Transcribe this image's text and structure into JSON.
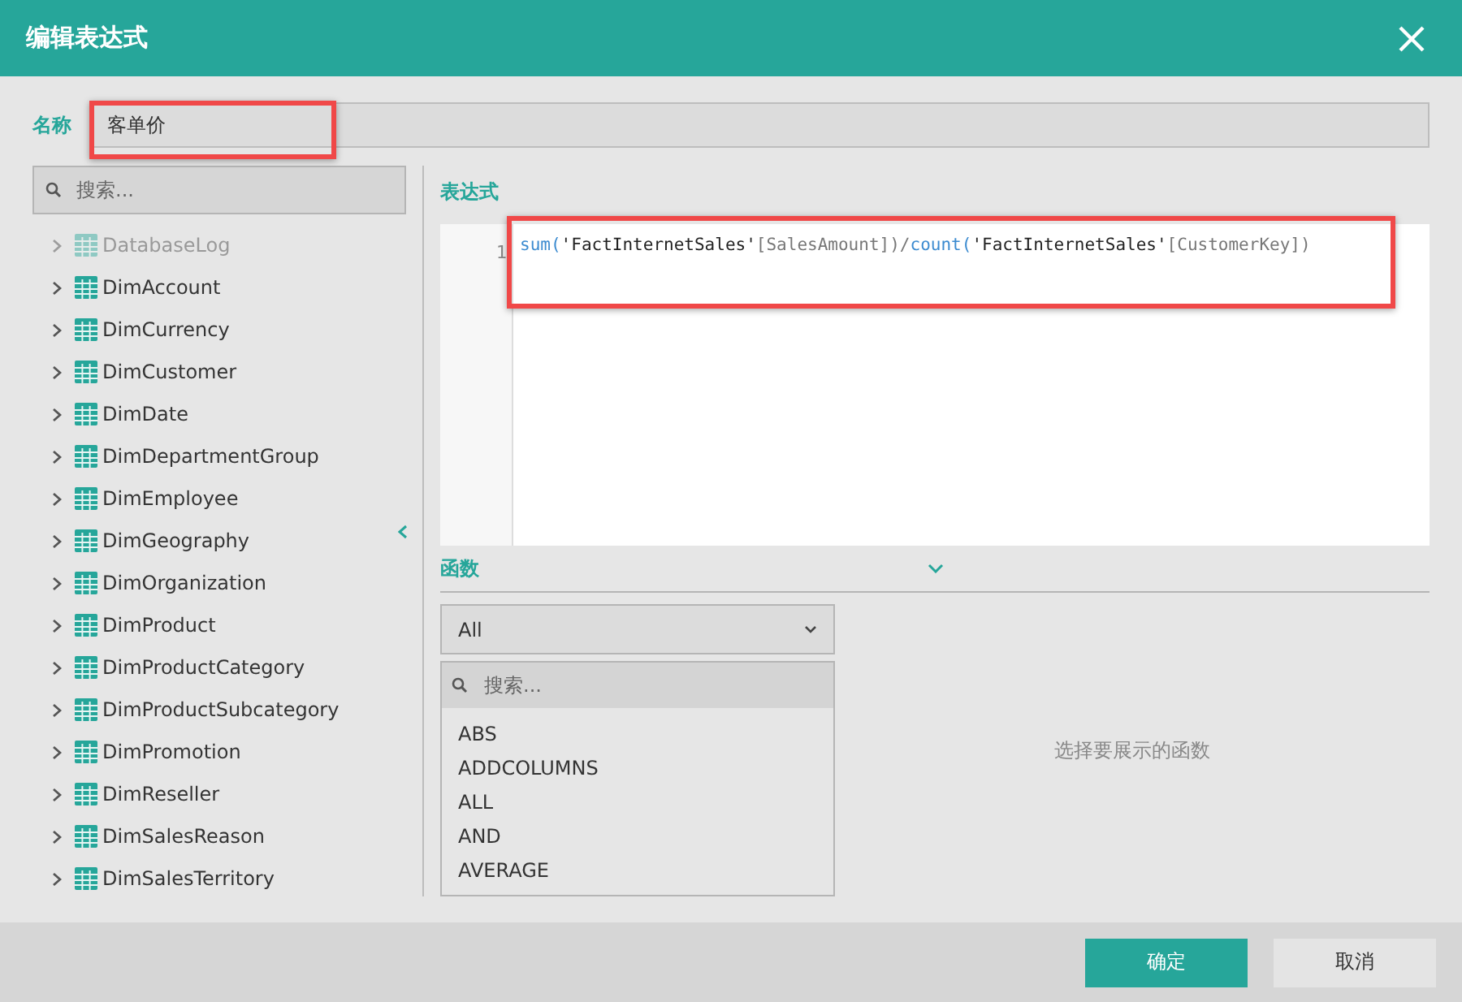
{
  "window": {
    "title": "编辑表达式"
  },
  "name_field": {
    "label": "名称",
    "value": "客单价",
    "highlighted": true
  },
  "table_search": {
    "placeholder": "搜索..."
  },
  "tables": [
    {
      "label": "DatabaseLog",
      "disabled": true
    },
    {
      "label": "DimAccount",
      "disabled": false
    },
    {
      "label": "DimCurrency",
      "disabled": false
    },
    {
      "label": "DimCustomer",
      "disabled": false
    },
    {
      "label": "DimDate",
      "disabled": false
    },
    {
      "label": "DimDepartmentGroup",
      "disabled": false
    },
    {
      "label": "DimEmployee",
      "disabled": false
    },
    {
      "label": "DimGeography",
      "disabled": false
    },
    {
      "label": "DimOrganization",
      "disabled": false
    },
    {
      "label": "DimProduct",
      "disabled": false
    },
    {
      "label": "DimProductCategory",
      "disabled": false
    },
    {
      "label": "DimProductSubcategory",
      "disabled": false
    },
    {
      "label": "DimPromotion",
      "disabled": false
    },
    {
      "label": "DimReseller",
      "disabled": false
    },
    {
      "label": "DimSalesReason",
      "disabled": false
    },
    {
      "label": "DimSalesTerritory",
      "disabled": false
    }
  ],
  "expression": {
    "heading": "表达式",
    "line_number": "1",
    "highlighted": true,
    "tokens": [
      {
        "kind": "func",
        "text": "sum("
      },
      {
        "kind": "table",
        "text": "'FactInternetSales'"
      },
      {
        "kind": "column",
        "text": "[SalesAmount]"
      },
      {
        "kind": "punct",
        "text": ")/"
      },
      {
        "kind": "func",
        "text": "count("
      },
      {
        "kind": "table",
        "text": "'FactInternetSales'"
      },
      {
        "kind": "column",
        "text": "[CustomerKey]"
      },
      {
        "kind": "punct",
        "text": ")"
      }
    ]
  },
  "functions": {
    "heading": "函数",
    "category": "All",
    "search": {
      "placeholder": "搜索..."
    },
    "items": [
      "ABS",
      "ADDCOLUMNS",
      "ALL",
      "AND",
      "AVERAGE"
    ],
    "hint": "选择要展示的函数"
  },
  "buttons": [
    {
      "label": "确定",
      "kind": "primary"
    },
    {
      "label": "取消",
      "kind": "secondary"
    }
  ]
}
